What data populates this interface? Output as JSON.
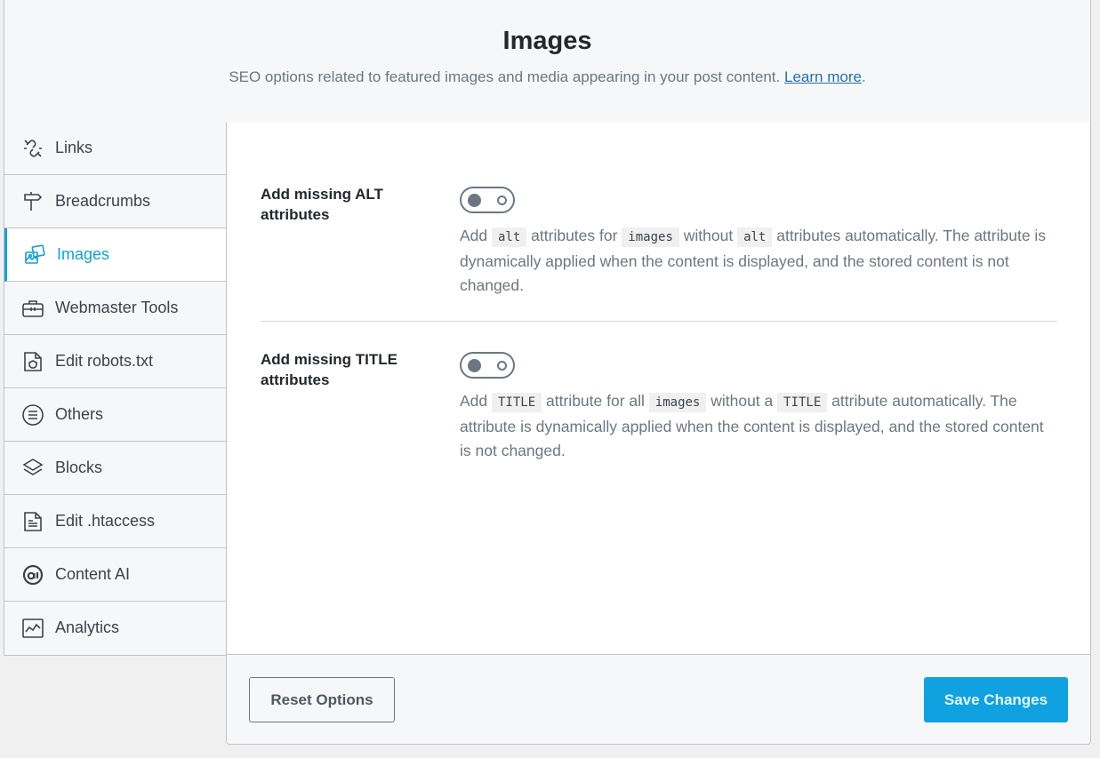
{
  "header": {
    "title": "Images",
    "subtitle": "SEO options related to featured images and media appearing in your post content.",
    "learn_more": "Learn more",
    "period": "."
  },
  "sidebar": {
    "items": [
      {
        "label": "Links",
        "icon": "link-icon"
      },
      {
        "label": "Breadcrumbs",
        "icon": "signpost-icon"
      },
      {
        "label": "Images",
        "icon": "images-icon",
        "active": true
      },
      {
        "label": "Webmaster Tools",
        "icon": "toolbox-icon"
      },
      {
        "label": "Edit robots.txt",
        "icon": "robots-file-icon"
      },
      {
        "label": "Others",
        "icon": "list-circle-icon"
      },
      {
        "label": "Blocks",
        "icon": "blocks-icon"
      },
      {
        "label": "Edit .htaccess",
        "icon": "htaccess-file-icon"
      },
      {
        "label": "Content AI",
        "icon": "content-ai-icon"
      },
      {
        "label": "Analytics",
        "icon": "analytics-icon"
      }
    ]
  },
  "settings": {
    "alt": {
      "label": "Add missing ALT attributes",
      "enabled": false,
      "desc": {
        "t1": "Add ",
        "c1": "alt",
        "t2": " attributes for ",
        "c2": "images",
        "t3": " without ",
        "c3": "alt",
        "t4": " attributes automatically. The attribute is dynamically applied when the content is displayed, and the stored content is not changed."
      }
    },
    "title": {
      "label": "Add missing TITLE attributes",
      "enabled": false,
      "desc": {
        "t1": "Add ",
        "c1": "TITLE",
        "t2": " attribute for all ",
        "c2": "images",
        "t3": " without a ",
        "c3": "TITLE",
        "t4": " attribute automatically. The attribute is dynamically applied when the content is displayed, and the stored content is not changed."
      }
    }
  },
  "footer": {
    "reset_label": "Reset Options",
    "save_label": "Save Changes"
  },
  "colors": {
    "accent": "#10a2e0",
    "link": "#2271b1",
    "muted_text": "#6c7781"
  }
}
